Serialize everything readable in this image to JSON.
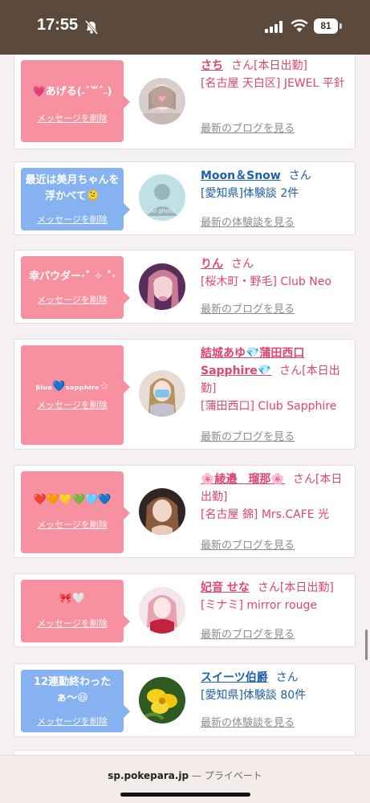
{
  "status_bar": {
    "time": "17:55",
    "battery": "81"
  },
  "bottom_bar": {
    "host": "sp.pokepara.jp",
    "separator": " — ",
    "label": "プライベート"
  },
  "cards": [
    {
      "bubble_text": "💗あげる(˶ˆ꒳ˆ˵)",
      "delete_label": "メッセージを削除",
      "name": "さち",
      "san": "さん",
      "name_extra": "[本日出勤]",
      "location": "[名古屋 天白区] JEWEL 平針",
      "link": "最新のブログを見る"
    },
    {
      "bubble_text": "最近は美月ちゃんを浮かべて🫠",
      "delete_label": "メッセージを削除",
      "name": "Moon＆Snow",
      "san": "さん",
      "name_extra": "",
      "location": "[愛知県]体験談 2件",
      "link": "最新の体験談を見る"
    },
    {
      "bubble_text": "幸パウダー·˚ ✧ ˚·",
      "delete_label": "メッセージを削除",
      "name": "りん",
      "san": "さん",
      "name_extra": "",
      "location": "[桜木町・野毛] Club Neo",
      "link": "最新のブログを見る"
    },
    {
      "bubble_text": "ᵦₗᵤₑ💙ₛₐₚₚₕᵢᵣₑ☆",
      "delete_label": "メッセージを削除",
      "name": "結城あゆ💎蒲田西口Sapphire💎",
      "san": "さん",
      "name_extra": "[本日出勤]",
      "location": "[蒲田西口] Club Sapphire",
      "link": "最新のブログを見る"
    },
    {
      "bubble_text": "❤️🧡💛💚🩵💙",
      "delete_label": "メッセージを削除",
      "name": "🌸綾邉　瑠那🌸",
      "san": "さん",
      "name_extra": "[本日出勤]",
      "location": "[名古屋 錦] Mrs.CAFE 光",
      "link": "最新のブログを見る"
    },
    {
      "bubble_text": "🎀🤍",
      "delete_label": "メッセージを削除",
      "name": "妃音 せな",
      "san": "さん",
      "name_extra": "[本日出勤]",
      "location": "[ミナミ] mirror rouge",
      "link": "最新のブログを見る"
    },
    {
      "bubble_text": "12連勤終わったぁ〜😆",
      "delete_label": "メッセージを削除",
      "name": "スイーツ伯爵",
      "san": "さん",
      "name_extra": "",
      "location": "[愛知県]体験談 80件",
      "link": "最新の体験談を見る"
    }
  ],
  "avatar_placeholder_text": "no photo",
  "colors": {
    "status_bar": "#5b4a3c",
    "bubble_pink": "#f7919f",
    "bubble_blue": "#86b2f2",
    "name_pink": "#e0456e",
    "name_blue": "#1d5fa8",
    "link_gray": "#8c8c8c"
  }
}
